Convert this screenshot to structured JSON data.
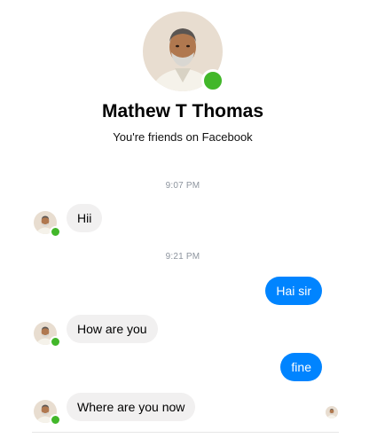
{
  "contact": {
    "name": "Mathew T Thomas",
    "subtitle": "You're friends on Facebook",
    "online": true
  },
  "conversation": {
    "timestamps": [
      "9:07 PM",
      "9:21 PM"
    ],
    "messages": [
      {
        "direction": "incoming",
        "text": "Hii"
      },
      {
        "direction": "outgoing",
        "text": "Hai sir"
      },
      {
        "direction": "incoming",
        "text": "How are you"
      },
      {
        "direction": "outgoing",
        "text": "fine"
      },
      {
        "direction": "incoming",
        "text": "Where are you now"
      }
    ]
  },
  "colors": {
    "outgoing_bubble": "#0084ff",
    "incoming_bubble": "#f1f0f0",
    "online_indicator": "#42b72a",
    "timestamp_text": "#8d949e"
  },
  "icons": {
    "avatar": "avatar-portrait",
    "online": "online-dot",
    "seen": "seen-avatar"
  }
}
